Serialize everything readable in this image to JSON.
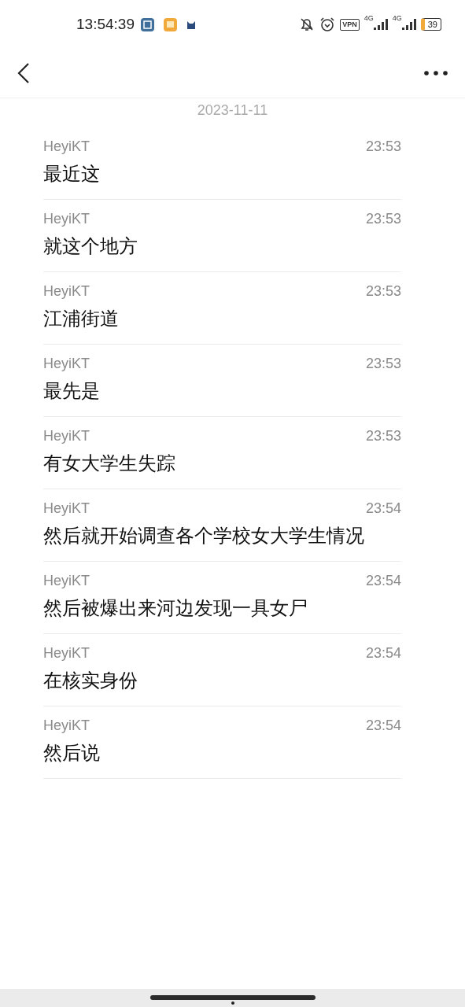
{
  "status_bar": {
    "time": "13:54:39",
    "vpn": "VPN",
    "network_1": "4G",
    "network_2": "4G",
    "battery": "39"
  },
  "date": "2023-11-11",
  "messages": [
    {
      "sender": "HeyiKT",
      "time": "23:53",
      "text": "最近这"
    },
    {
      "sender": "HeyiKT",
      "time": "23:53",
      "text": "就这个地方"
    },
    {
      "sender": "HeyiKT",
      "time": "23:53",
      "text": "江浦街道"
    },
    {
      "sender": "HeyiKT",
      "time": "23:53",
      "text": "最先是"
    },
    {
      "sender": "HeyiKT",
      "time": "23:53",
      "text": "有女大学生失踪"
    },
    {
      "sender": "HeyiKT",
      "time": "23:54",
      "text": "然后就开始调查各个学校女大学生情况"
    },
    {
      "sender": "HeyiKT",
      "time": "23:54",
      "text": "然后被爆出来河边发现一具女尸"
    },
    {
      "sender": "HeyiKT",
      "time": "23:54",
      "text": "在核实身份"
    },
    {
      "sender": "HeyiKT",
      "time": "23:54",
      "text": "然后说"
    }
  ]
}
